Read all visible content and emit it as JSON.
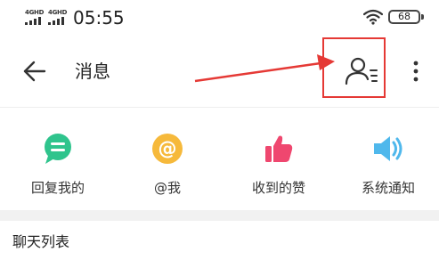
{
  "status_bar": {
    "signal_1_label": "4GHD",
    "signal_2_label": "4GHD",
    "time": "05:55",
    "battery_level": "68",
    "wifi_icon": "wifi-icon"
  },
  "toolbar": {
    "back_icon": "arrow-left-icon",
    "title": "消息",
    "contacts_icon": "contacts-list-icon",
    "more_icon": "more-vertical-icon"
  },
  "annotation": {
    "highlight_color": "#e53935"
  },
  "actions": [
    {
      "label": "回复我的",
      "icon": "reply-bubble-icon",
      "color": "#2fc48d"
    },
    {
      "label": "@我",
      "icon": "at-icon",
      "color": "#f6b93b"
    },
    {
      "label": "收到的赞",
      "icon": "thumbs-up-icon",
      "color": "#ef476f"
    },
    {
      "label": "系统通知",
      "icon": "speaker-icon",
      "color": "#4fb8ec"
    }
  ],
  "sections": {
    "chat_list_title": "聊天列表"
  }
}
